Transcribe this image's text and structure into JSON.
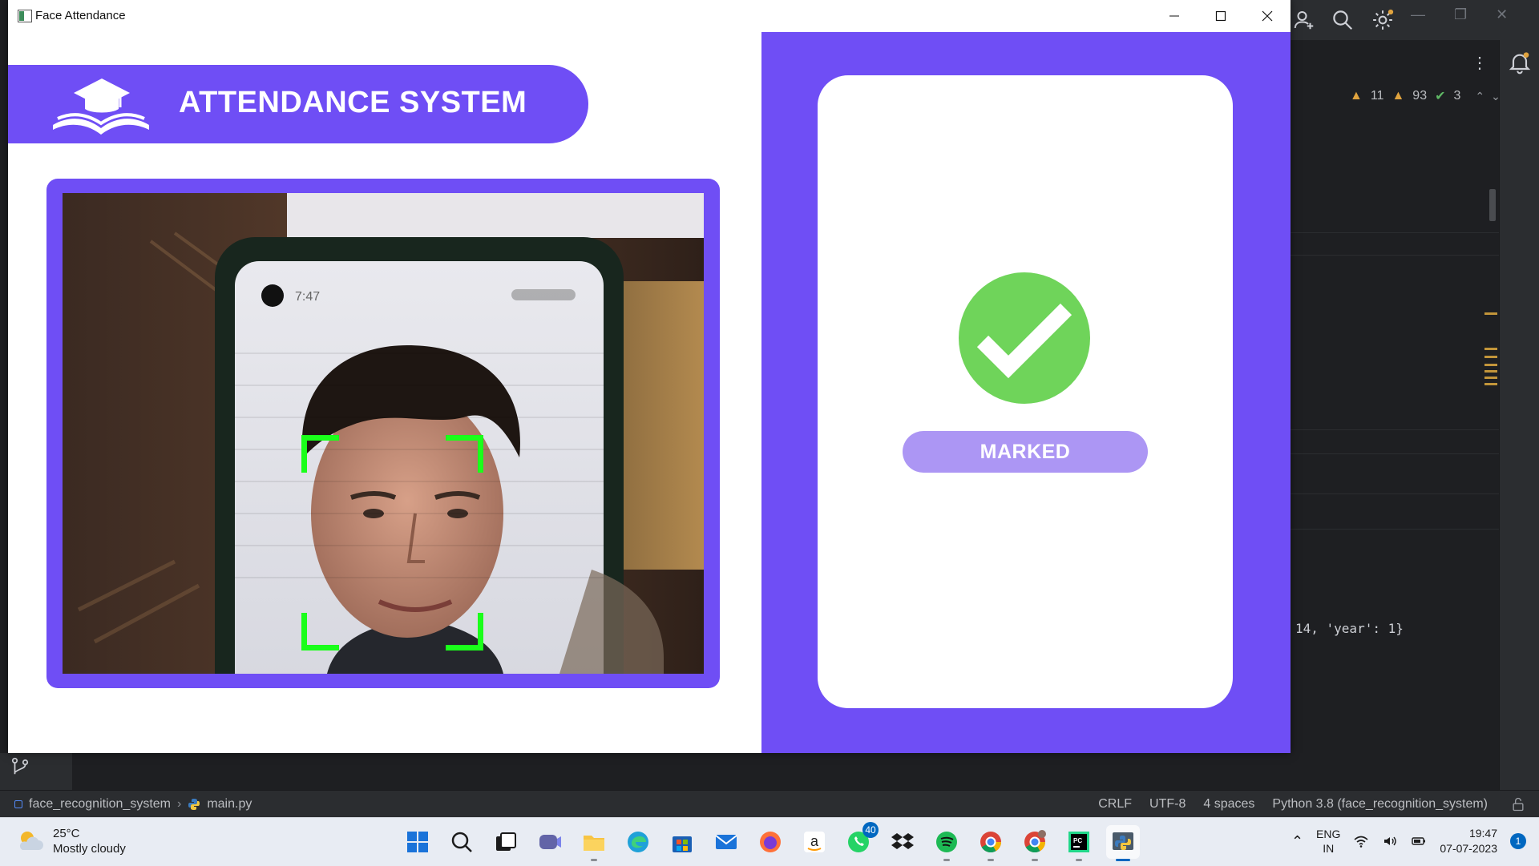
{
  "window": {
    "title": "Face Attendance"
  },
  "app": {
    "banner_title": "ATTENDANCE SYSTEM",
    "status_label": "MARKED",
    "status_color": "#6fd45a",
    "accent": "#6f4ef5",
    "face_box_color": "#1aff1a",
    "phone_clock": "7:47"
  },
  "ide": {
    "inspections": {
      "warnings_a": "11",
      "warnings_b": "93",
      "ok": "3"
    },
    "console_text": "14, 'year': 1}",
    "statusbar": {
      "project": "face_recognition_system",
      "file": "main.py",
      "line_sep": "CRLF",
      "encoding": "UTF-8",
      "indent": "4 spaces",
      "interpreter": "Python 3.8 (face_recognition_system)"
    }
  },
  "taskbar": {
    "weather_temp": "25°C",
    "weather_desc": "Mostly cloudy",
    "apps": [
      {
        "name": "start"
      },
      {
        "name": "search"
      },
      {
        "name": "task-view"
      },
      {
        "name": "teams-chat"
      },
      {
        "name": "file-explorer"
      },
      {
        "name": "edge"
      },
      {
        "name": "microsoft-store"
      },
      {
        "name": "mail"
      },
      {
        "name": "firefox"
      },
      {
        "name": "amazon"
      },
      {
        "name": "whatsapp",
        "badge": "40"
      },
      {
        "name": "dropbox"
      },
      {
        "name": "spotify"
      },
      {
        "name": "chrome"
      },
      {
        "name": "chrome-profile"
      },
      {
        "name": "pycharm"
      },
      {
        "name": "python"
      }
    ],
    "lang_line1": "ENG",
    "lang_line2": "IN",
    "time": "19:47",
    "date": "07-07-2023",
    "notification_count": "1"
  }
}
